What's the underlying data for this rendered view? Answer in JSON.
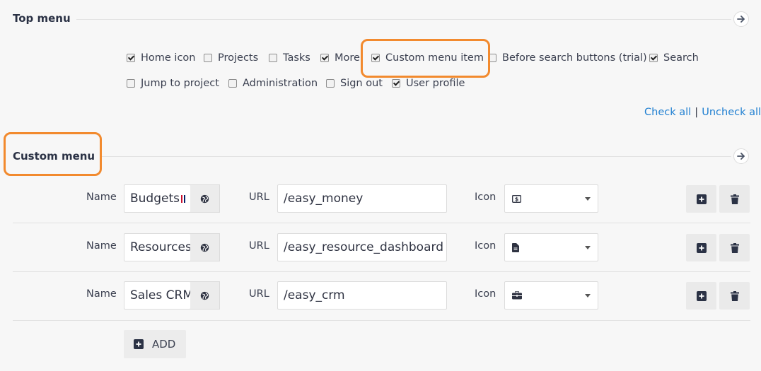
{
  "top_menu": {
    "title": "Top menu",
    "row1": [
      {
        "label": "Home icon",
        "checked": true
      },
      {
        "label": "Projects",
        "checked": false
      },
      {
        "label": "Tasks",
        "checked": false
      },
      {
        "label": "More",
        "checked": true
      },
      {
        "label": "Custom menu item",
        "checked": true
      },
      {
        "label": "Before search buttons (trial)",
        "checked": false
      },
      {
        "label": "Search",
        "checked": true
      }
    ],
    "row2": [
      {
        "label": "Jump to project",
        "checked": false
      },
      {
        "label": "Administration",
        "checked": false
      },
      {
        "label": "Sign out",
        "checked": false
      },
      {
        "label": "User profile",
        "checked": true
      }
    ],
    "check_all": "Check all",
    "separator": "|",
    "uncheck_all": "Uncheck all"
  },
  "custom_menu": {
    "title": "Custom menu",
    "name_label": "Name",
    "url_label": "URL",
    "icon_label": "Icon",
    "items": [
      {
        "name": "Budgets",
        "url": "/easy_money",
        "icon": "money-icon"
      },
      {
        "name": "Resources",
        "url": "/easy_resource_dashboard",
        "icon": "file-icon"
      },
      {
        "name": "Sales CRM",
        "url": "/easy_crm",
        "icon": "briefcase-icon"
      }
    ],
    "add_label": "ADD"
  },
  "colors": {
    "highlight": "#f28a2e",
    "link": "#1f7fd1",
    "heading": "#2b3245"
  }
}
